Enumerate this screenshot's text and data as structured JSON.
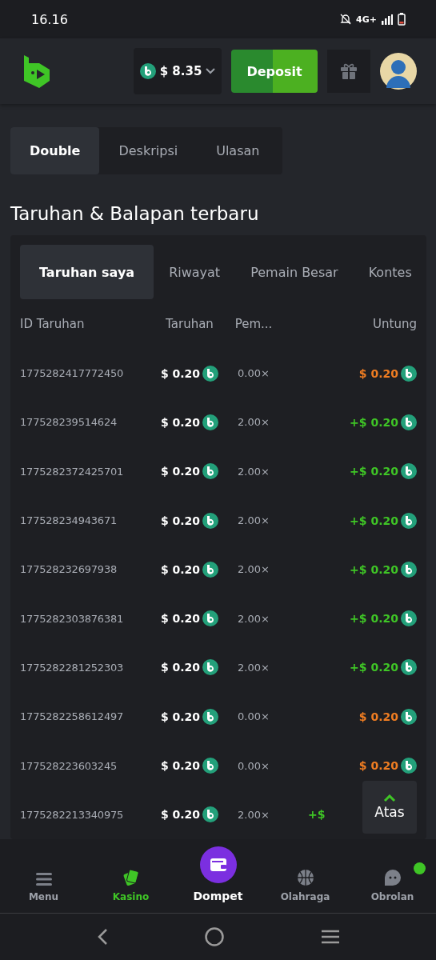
{
  "status_bar": {
    "time": "16.16",
    "network": "4G+"
  },
  "header": {
    "balance": "$ 8.35",
    "deposit_label": "Deposit"
  },
  "game_tabs": [
    {
      "label": "Double",
      "selected": true
    },
    {
      "label": "Deskripsi",
      "selected": false
    },
    {
      "label": "Ulasan",
      "selected": false
    }
  ],
  "section_title": "Taruhan & Balapan terbaru",
  "bet_tabs": [
    {
      "label": "Taruhan saya",
      "selected": true
    },
    {
      "label": "Riwayat",
      "selected": false
    },
    {
      "label": "Pemain Besar",
      "selected": false
    },
    {
      "label": "Kontes",
      "selected": false
    }
  ],
  "table": {
    "columns": [
      "ID Taruhan",
      "Taruhan",
      "Pem...",
      "Untung"
    ],
    "rows": [
      {
        "id": "1775282417772450",
        "bet": "$ 0.20",
        "multiplier": "0.00×",
        "profit": "$ 0.20",
        "kind": "loss",
        "coin": true
      },
      {
        "id": "177528239514624",
        "bet": "$ 0.20",
        "multiplier": "2.00×",
        "profit": "+$ 0.20",
        "kind": "win",
        "coin": true
      },
      {
        "id": "1775282372425701",
        "bet": "$ 0.20",
        "multiplier": "2.00×",
        "profit": "+$ 0.20",
        "kind": "win",
        "coin": true
      },
      {
        "id": "177528234943671",
        "bet": "$ 0.20",
        "multiplier": "2.00×",
        "profit": "+$ 0.20",
        "kind": "win",
        "coin": true
      },
      {
        "id": "177528232697938",
        "bet": "$ 0.20",
        "multiplier": "2.00×",
        "profit": "+$ 0.20",
        "kind": "win",
        "coin": true
      },
      {
        "id": "1775282303876381",
        "bet": "$ 0.20",
        "multiplier": "2.00×",
        "profit": "+$ 0.20",
        "kind": "win",
        "coin": true
      },
      {
        "id": "1775282281252303",
        "bet": "$ 0.20",
        "multiplier": "2.00×",
        "profit": "+$ 0.20",
        "kind": "win",
        "coin": true
      },
      {
        "id": "1775282258612497",
        "bet": "$ 0.20",
        "multiplier": "0.00×",
        "profit": "$ 0.20",
        "kind": "loss",
        "coin": true
      },
      {
        "id": "177528223603245",
        "bet": "$ 0.20",
        "multiplier": "0.00×",
        "profit": "$ 0.20",
        "kind": "loss",
        "coin": true
      },
      {
        "id": "1775282213340975",
        "bet": "$ 0.20",
        "multiplier": "2.00×",
        "profit": "+$",
        "kind": "win",
        "coin": false
      }
    ]
  },
  "scroll_top": {
    "label": "Atas"
  },
  "bottom_nav": [
    {
      "label": "Menu",
      "kind": "menu",
      "selected": false,
      "badge": false
    },
    {
      "label": "Kasino",
      "kind": "casino",
      "selected": true,
      "badge": false
    },
    {
      "label": "Dompet",
      "kind": "wallet",
      "selected": false,
      "badge": false
    },
    {
      "label": "Olahraga",
      "kind": "sports",
      "selected": false,
      "badge": false
    },
    {
      "label": "Obrolan",
      "kind": "chat",
      "selected": false,
      "badge": true
    }
  ]
}
